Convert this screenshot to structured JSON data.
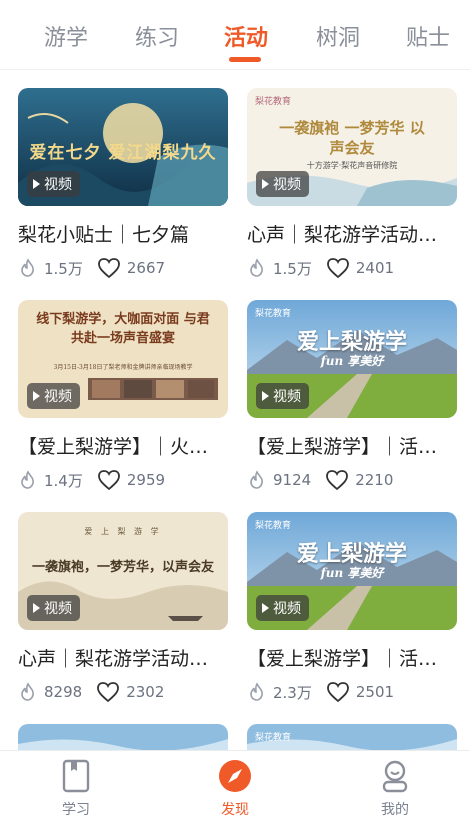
{
  "tabs": [
    {
      "label": "游学"
    },
    {
      "label": "练习"
    },
    {
      "label": "活动",
      "active": true
    },
    {
      "label": "树洞"
    },
    {
      "label": "贴士"
    }
  ],
  "cards": [
    {
      "title": "梨花小贴士｜七夕篇",
      "badge": "视频",
      "likes": "1.5万",
      "hearts": "2667",
      "thumb_text": "爱在七夕 爱江湖梨九久",
      "theme": "qixi"
    },
    {
      "title": "心声｜梨花游学活动…",
      "badge": "视频",
      "likes": "1.5万",
      "hearts": "2401",
      "thumb_text": "一袭旗袍 一梦芳华 以声会友",
      "thumb_subtext": "十方游学·梨花声音研修院",
      "brand": "梨花教育",
      "theme": "qipao"
    },
    {
      "title": "【爱上梨游学】｜火…",
      "badge": "视频",
      "likes": "1.4万",
      "hearts": "2959",
      "thumb_text": "线下梨游学，大咖面对面 与君共赴一场声音盛宴",
      "thumb_subtext": "3月15日-3月18日了梨老师和金牌讲师亲临现场教学",
      "theme": "offline"
    },
    {
      "title": "【爱上梨游学】｜活…",
      "badge": "视频",
      "likes": "9124",
      "hearts": "2210",
      "thumb_text": "爱上梨游学",
      "thumb_subtext": "fun 享美好",
      "brand": "梨花教育",
      "theme": "landscape"
    },
    {
      "title": "心声｜梨花游学活动…",
      "badge": "视频",
      "likes": "8298",
      "hearts": "2302",
      "thumb_text": "一袭旗袍，一梦芳华，以声会友",
      "thumb_subtext": "爱 上 梨 游 学",
      "theme": "ink"
    },
    {
      "title": "【爱上梨游学】｜活…",
      "badge": "视频",
      "likes": "2.3万",
      "hearts": "2501",
      "thumb_text": "爱上梨游学",
      "thumb_subtext": "fun 享美好",
      "brand": "梨花教育",
      "theme": "landscape"
    }
  ],
  "partial_cards": [
    {
      "brand": ""
    },
    {
      "brand": "梨花教育"
    }
  ],
  "bottom_nav": [
    {
      "label": "学习",
      "icon": "book-icon"
    },
    {
      "label": "发现",
      "icon": "compass-icon",
      "active": true
    },
    {
      "label": "我的",
      "icon": "profile-icon"
    }
  ],
  "colors": {
    "accent": "#f05a28",
    "muted": "#8a8f99"
  }
}
